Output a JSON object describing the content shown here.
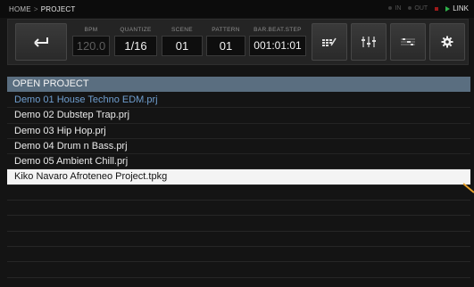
{
  "breadcrumb": {
    "home": "HOME",
    "separator": ">",
    "current": "PROJECT"
  },
  "status": {
    "in_label": "IN",
    "out_label": "OUT",
    "link_label": "LINK",
    "colors": {
      "in": "#3a3a3a",
      "out": "#3a3a3a",
      "stop": "#9e1a1a",
      "play": "#2fb34b"
    }
  },
  "controls": {
    "back_icon": "return-arrow-icon",
    "bpm": {
      "label": "BPM",
      "value": "120.0"
    },
    "quantize": {
      "label": "QUANTIZE",
      "value": "1/16"
    },
    "scene": {
      "label": "SCENE",
      "value": "01"
    },
    "pattern": {
      "label": "PATTERN",
      "value": "01"
    },
    "bar_beat_step": {
      "label": "BAR.BEAT.STEP",
      "value": "001:01:01"
    },
    "icons": [
      "pattern-grid-edit-icon",
      "mixer-faders-icon",
      "sequence-notes-icon",
      "gear-icon"
    ]
  },
  "panel": {
    "title": "OPEN PROJECT",
    "files": [
      {
        "name": "Demo 01 House Techno EDM.prj",
        "state": "active"
      },
      {
        "name": "Demo 02 Dubstep Trap.prj",
        "state": "normal"
      },
      {
        "name": "Demo 03 Hip Hop.prj",
        "state": "normal"
      },
      {
        "name": "Demo 04 Drum n Bass.prj",
        "state": "normal"
      },
      {
        "name": "Demo 05 Ambient Chill.prj",
        "state": "normal"
      },
      {
        "name": "Kiko Navaro Afroteneo Project.tpkg",
        "state": "selected"
      }
    ]
  },
  "theme": {
    "accent": "#5a6e80",
    "active_text": "#6f9ecf",
    "pointer": "#e8a02a"
  }
}
